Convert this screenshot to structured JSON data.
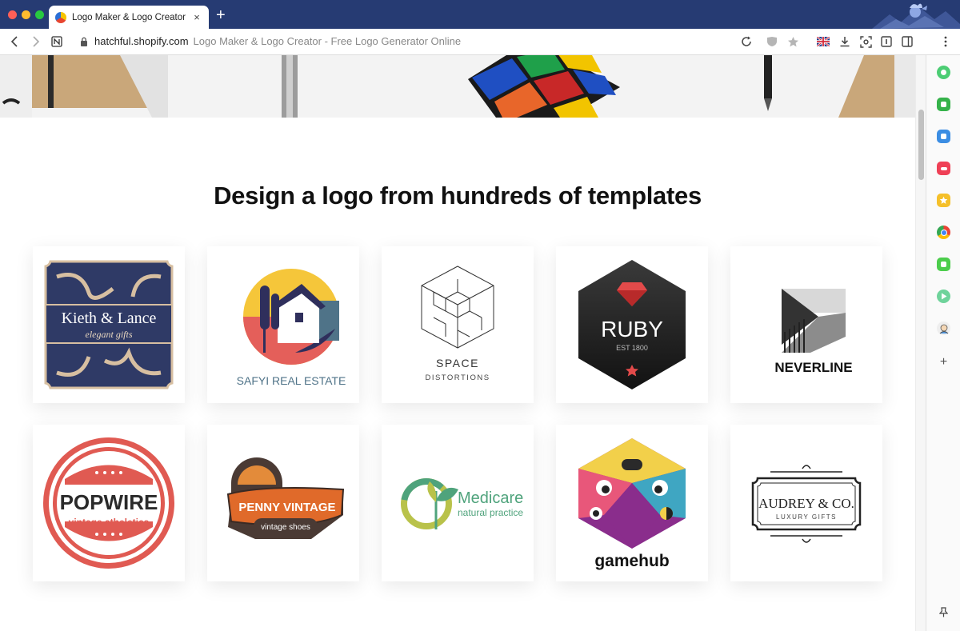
{
  "browser": {
    "tab_title": "Logo Maker & Logo Creator - Fr",
    "tab_close": "×",
    "new_tab": "+",
    "url_host": "hatchful.shopify.com",
    "url_title": "Logo Maker & Logo Creator - Free Logo Generator Online",
    "accent": "#263b73"
  },
  "page": {
    "headline": "Design a logo from hundreds of templates"
  },
  "logos": {
    "kieth": {
      "name": "Kieth & Lance",
      "tagline": "elegant gifts"
    },
    "safyi": {
      "name": "SAFYI REAL ESTATE"
    },
    "space": {
      "name": "SPACE",
      "tagline": "DISTORTIONS"
    },
    "ruby": {
      "name": "RUBY",
      "tagline": "EST 1800"
    },
    "neverline": {
      "name": "NEVERLINE"
    },
    "popwire": {
      "name": "POPWIRE",
      "tagline": "vintage atheletics"
    },
    "penny": {
      "name": "PENNY VINTAGE",
      "tagline": "vintage shoes"
    },
    "medicare": {
      "name": "Medicare",
      "tagline": "natural practice"
    },
    "gamehub": {
      "name": "gamehub"
    },
    "audrey": {
      "name": "AUDREY & CO.",
      "tagline": "LUXURY GIFTS"
    }
  },
  "icons": {
    "toolbar": [
      "back-icon",
      "forward-icon",
      "notion-icon",
      "lock-icon",
      "reload-icon",
      "shield-icon",
      "star-icon",
      "uk-flag-icon",
      "download-icon",
      "screenshot-icon",
      "reader-icon",
      "sidebar-icon",
      "more-icon"
    ],
    "sidebar": [
      "app-green-circle-icon",
      "app-green-chat-icon",
      "app-blue-box-icon",
      "pocket-icon",
      "bookmark-star-icon",
      "chrome-icon",
      "app-green-square-icon",
      "play-icon",
      "avatar-icon",
      "add-icon",
      "pin-icon"
    ]
  }
}
